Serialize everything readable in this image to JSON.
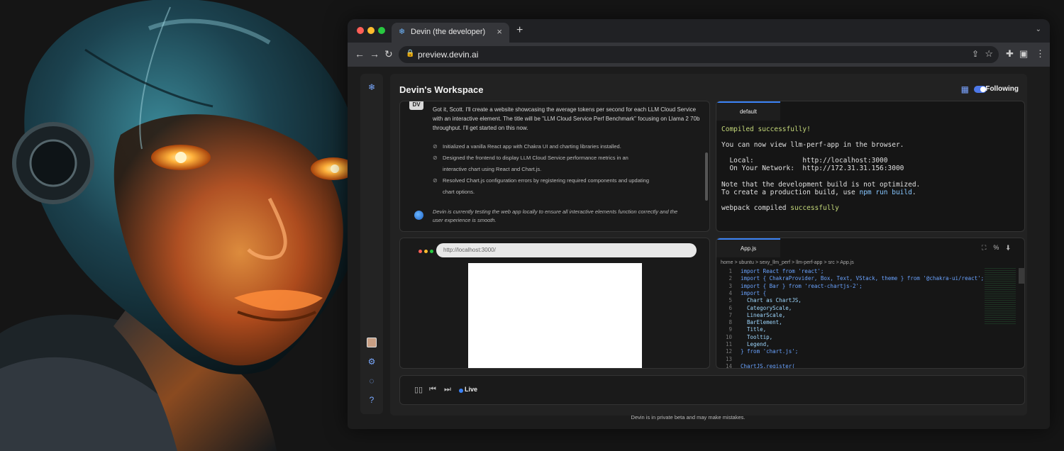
{
  "browser": {
    "tab_title": "Devin (the developer)",
    "url": "preview.devin.ai"
  },
  "workspace": {
    "title": "Devin's Workspace",
    "following_label": "Following"
  },
  "chat": {
    "avatar_text": "DV",
    "message": "Got it, Scott. I'll create a website showcasing the average tokens per second for each LLM Cloud Service with an interactive element. The title will be \"LLM Cloud Service Perf Benchmark\" focusing on Llama 2 70b throughput. I'll get started on this now.",
    "steps": [
      {
        "line1": "Initialized a vanilla React app with Chakra UI and charting libraries installed.",
        "line2": ""
      },
      {
        "line1": "Designed the frontend to display LLM Cloud Service performance metrics in an",
        "line2": "interactive chart using React and Chart.js."
      },
      {
        "line1": "Resolved Chart.js configuration errors by registering required components and updating",
        "line2": "chart options."
      }
    ],
    "status": "Devin is currently testing the web app locally to ensure all interactive elements function correctly and the user experience is smooth."
  },
  "terminal": {
    "tab": "default",
    "lines": {
      "compiled": "Compiled successfully!",
      "view": "You can now view llm-perf-app in the browser.",
      "local": "  Local:            http://localhost:3000",
      "network": "  On Your Network:  http://172.31.31.156:3000",
      "note1": "Note that the development build is not optimized.",
      "note2_prefix": "To create a production build, use ",
      "note2_cmd": "npm run build",
      "note2_suffix": ".",
      "webpack_prefix": "webpack compiled ",
      "webpack_status": "successfully"
    }
  },
  "preview": {
    "url": "http://localhost:3000/"
  },
  "editor": {
    "tab": "App.js",
    "breadcrumb": "home > ubuntu > sexy_llm_perf > llm-perf-app > src > App.js",
    "lines": [
      {
        "n": "1",
        "t": "import React from 'react';"
      },
      {
        "n": "2",
        "t": "import { ChakraProvider, Box, Text, VStack, theme } from '@chakra-ui/react';"
      },
      {
        "n": "3",
        "t": "import { Bar } from 'react-chartjs-2';"
      },
      {
        "n": "4",
        "t": "import {"
      },
      {
        "n": "5",
        "t": "  Chart as ChartJS,"
      },
      {
        "n": "6",
        "t": "  CategoryScale,"
      },
      {
        "n": "7",
        "t": "  LinearScale,"
      },
      {
        "n": "8",
        "t": "  BarElement,"
      },
      {
        "n": "9",
        "t": "  Title,"
      },
      {
        "n": "10",
        "t": "  Tooltip,"
      },
      {
        "n": "11",
        "t": "  Legend,"
      },
      {
        "n": "12",
        "t": "} from 'chart.js';"
      },
      {
        "n": "13",
        "t": ""
      },
      {
        "n": "14",
        "t": "ChartJS.register("
      }
    ]
  },
  "player": {
    "live_label": "Live"
  },
  "footer": "Devin is in private beta and may make mistakes."
}
